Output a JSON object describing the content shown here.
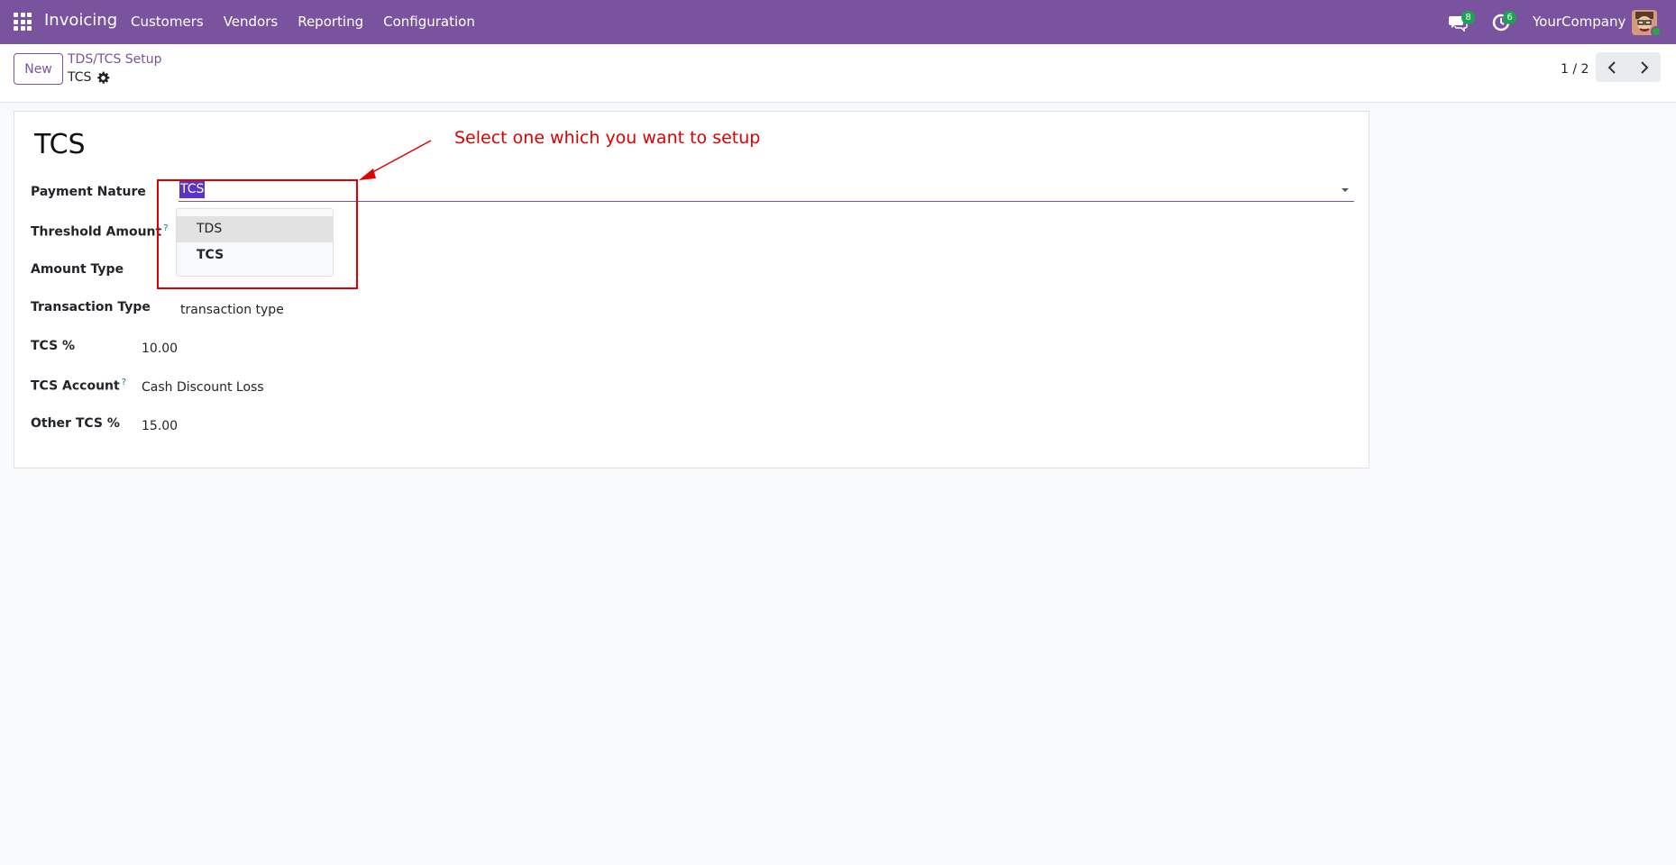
{
  "navbar": {
    "app_name": "Invoicing",
    "menu": [
      "Customers",
      "Vendors",
      "Reporting",
      "Configuration"
    ],
    "messages_count": "8",
    "activities_count": "6",
    "company": "YourCompany",
    "bg_color": "#7a539e"
  },
  "control_panel": {
    "new_label": "New",
    "breadcrumb_parent": "TDS/TCS Setup",
    "breadcrumb_current": "TCS",
    "pager_value": "1 / 2"
  },
  "form": {
    "title": "TCS",
    "payment_nature": {
      "label": "Payment Nature",
      "value": "TCS",
      "options": [
        "TDS",
        "TCS"
      ]
    },
    "threshold_amount": {
      "label": "Threshold Amount",
      "help": "?"
    },
    "amount_type": {
      "label": "Amount Type"
    },
    "transaction_type": {
      "label": "Transaction Type",
      "value": "transaction type"
    },
    "tcs_percent": {
      "label": "TCS %",
      "value": "10.00"
    },
    "tcs_account": {
      "label": "TCS Account",
      "help": "?",
      "value": "Cash Discount Loss"
    },
    "other_tcs_percent": {
      "label": "Other TCS %",
      "value": "15.00"
    }
  },
  "annotation": {
    "text": "Select one which you want to setup",
    "color": "#e00000"
  }
}
